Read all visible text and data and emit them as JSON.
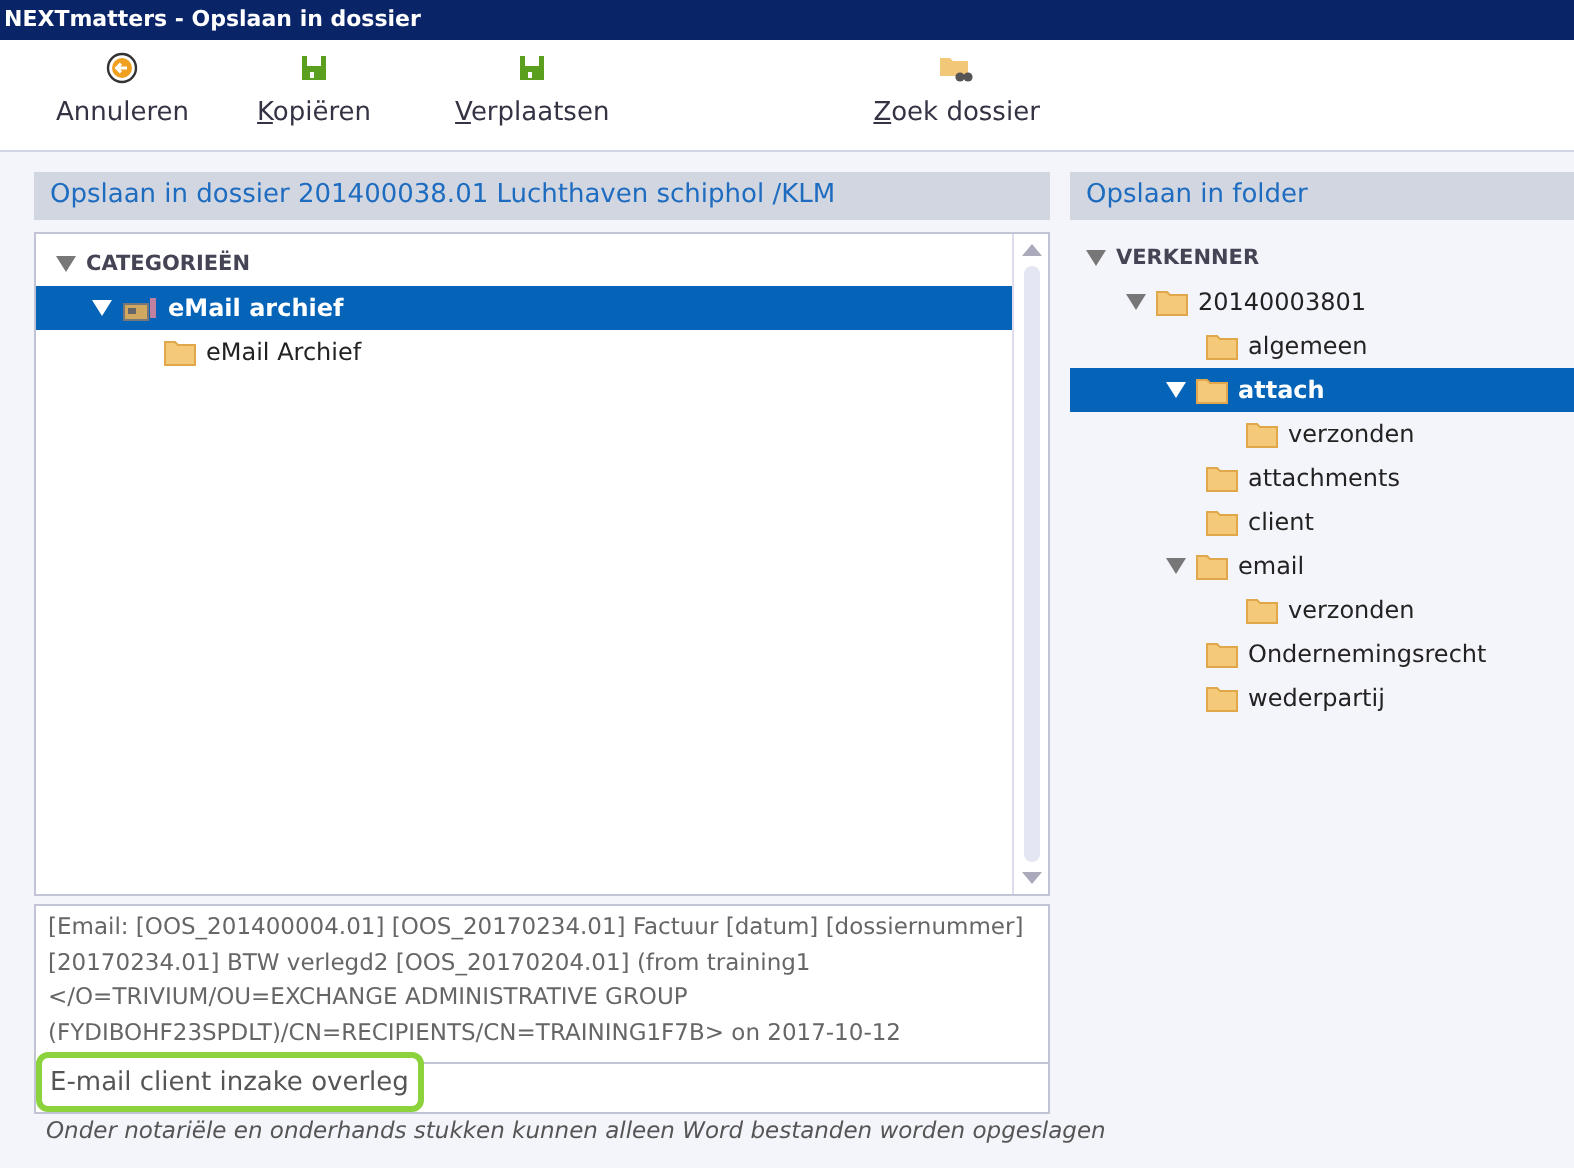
{
  "window": {
    "title": "NEXTmatters - Opslaan in dossier"
  },
  "toolbar": [
    {
      "label": "Annuleren",
      "kind": "cancel",
      "accelerator": false
    },
    {
      "label": "Kopiëren",
      "kind": "save",
      "accelerator": true
    },
    {
      "label": "Verplaatsen",
      "kind": "save",
      "accelerator": true
    },
    {
      "label": "Zoek dossier",
      "kind": "search-folder",
      "accelerator": true
    }
  ],
  "left_panel": {
    "title": "Opslaan in dossier 201400038.01 Luchthaven schiphol /KLM",
    "tree": [
      {
        "label": "CATEGORIEËN",
        "kind": "header",
        "expanded": true,
        "selected": false,
        "children": [
          {
            "label": "eMail archief",
            "kind": "archive",
            "expanded": true,
            "selected": true,
            "children": [
              {
                "label": "eMail Archief",
                "kind": "folder",
                "selected": false
              }
            ]
          }
        ]
      }
    ],
    "description": "[Email: [OOS_201400004.01] [OOS_20170234.01] Factuur [datum] [dossiernummer] [20170234.01] BTW verlegd2 [OOS_20170204.01] (from training1 </O=TRIVIUM/OU=EXCHANGE ADMINISTRATIVE GROUP (FYDIBOHF23SPDLT)/CN=RECIPIENTS/CN=TRAINING1F7B> on 2017-10-12",
    "name_field": {
      "value": "E-mail client inzake overleg",
      "focused": true
    },
    "note": "Onder notariële en onderhands stukken kunnen alleen Word bestanden worden opgeslagen"
  },
  "right_panel": {
    "title": "Opslaan in folder",
    "tree": [
      {
        "label": "VERKENNER",
        "kind": "header",
        "expanded": true,
        "selected": false,
        "children": [
          {
            "label": "20140003801",
            "kind": "folder",
            "expanded": true,
            "selected": false,
            "children": [
              {
                "label": "algemeen",
                "kind": "folder",
                "selected": false
              },
              {
                "label": "attach",
                "kind": "folder",
                "expanded": true,
                "selected": true,
                "children": [
                  {
                    "label": "verzonden",
                    "kind": "folder",
                    "selected": false
                  }
                ]
              },
              {
                "label": "attachments",
                "kind": "folder",
                "selected": false
              },
              {
                "label": "client",
                "kind": "folder",
                "selected": false
              },
              {
                "label": "email",
                "kind": "folder",
                "expanded": true,
                "selected": false,
                "children": [
                  {
                    "label": "verzonden",
                    "kind": "folder",
                    "selected": false
                  }
                ]
              },
              {
                "label": "Ondernemingsrecht",
                "kind": "folder",
                "selected": false
              },
              {
                "label": "wederpartij",
                "kind": "folder",
                "selected": false
              }
            ]
          }
        ]
      }
    ]
  }
}
